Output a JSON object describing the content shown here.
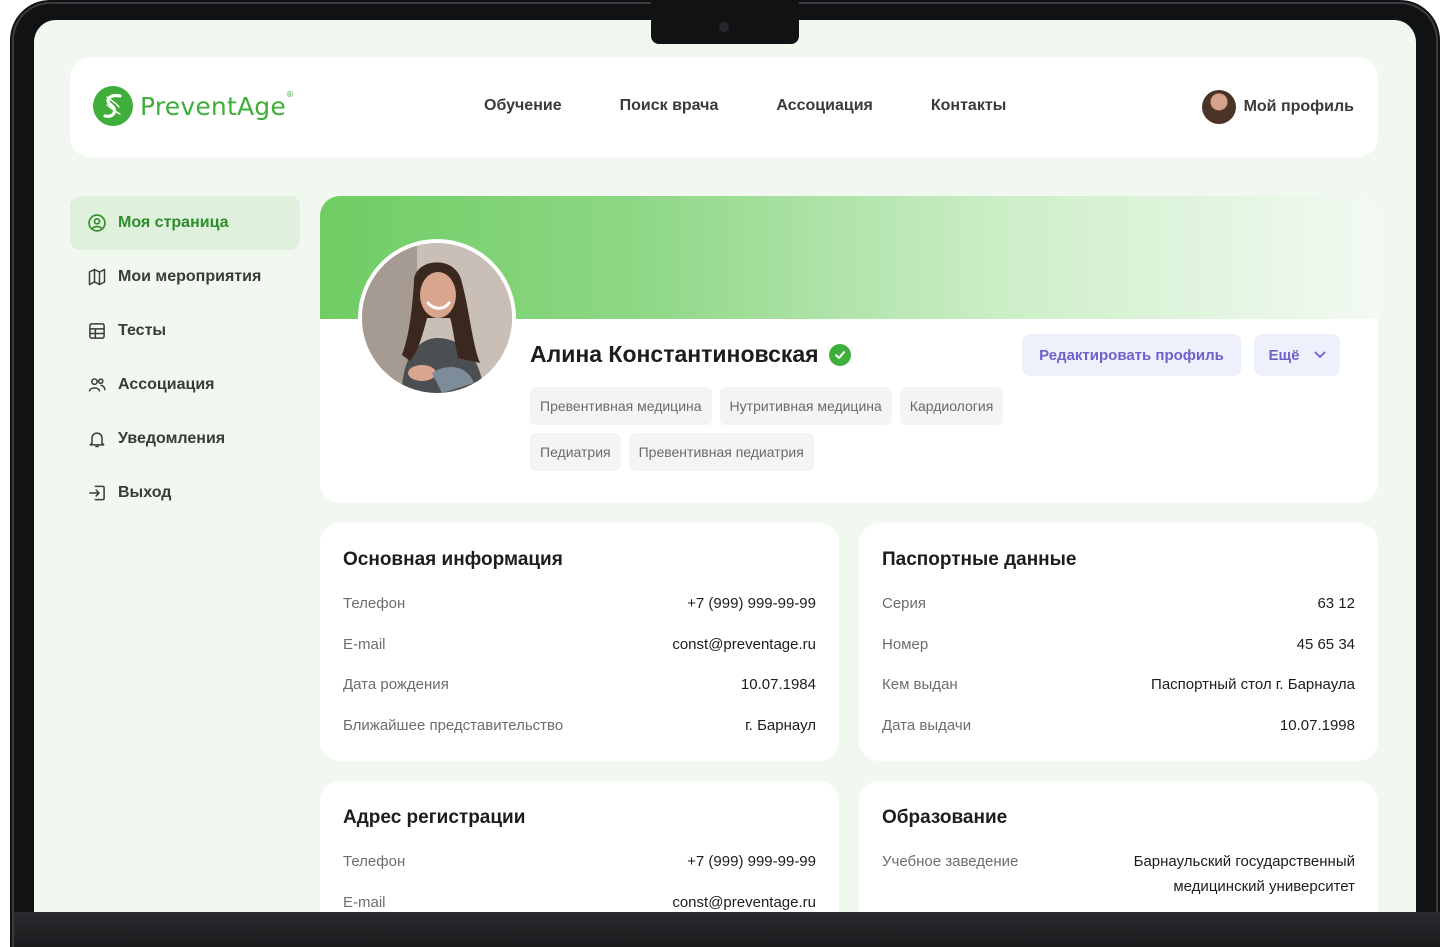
{
  "header": {
    "logo_text": "PreventAge",
    "logo_reg": "®",
    "nav": [
      "Обучение",
      "Поиск врача",
      "Ассоциация",
      "Контакты"
    ],
    "profile_label": "Мой профиль"
  },
  "sidebar": {
    "items": [
      {
        "label": "Моя страница",
        "icon": "user-circle-icon",
        "active": true
      },
      {
        "label": "Мои мероприятия",
        "icon": "map-icon",
        "active": false
      },
      {
        "label": "Тесты",
        "icon": "table-icon",
        "active": false
      },
      {
        "label": "Ассоциация",
        "icon": "users-icon",
        "active": false
      },
      {
        "label": "Уведомления",
        "icon": "bell-icon",
        "active": false
      },
      {
        "label": "Выход",
        "icon": "logout-icon",
        "active": false
      }
    ]
  },
  "profile": {
    "name": "Алина Константиновская",
    "verified": true,
    "edit_button": "Редактировать профиль",
    "more_button": "Ещё",
    "tags": [
      "Превентивная медицина",
      "Нутритивная медицина",
      "Кардиология",
      "Педиатрия",
      "Превентивная педиатрия"
    ]
  },
  "cards": {
    "basic": {
      "title": "Основная информация",
      "rows": [
        {
          "label": "Телефон",
          "value": "+7 (999) 999-99-99"
        },
        {
          "label": "E-mail",
          "value": "const@preventage.ru"
        },
        {
          "label": "Дата рождения",
          "value": "10.07.1984"
        },
        {
          "label": "Ближайшее представительство",
          "value": "г. Барнаул"
        }
      ]
    },
    "passport": {
      "title": "Паспортные данные",
      "rows": [
        {
          "label": "Серия",
          "value": "63 12"
        },
        {
          "label": "Номер",
          "value": "45 65 34"
        },
        {
          "label": "Кем выдан",
          "value": "Паспортный стол г. Барнаула"
        },
        {
          "label": "Дата выдачи",
          "value": "10.07.1998"
        }
      ]
    },
    "address": {
      "title": "Адрес регистрации",
      "rows": [
        {
          "label": "Телефон",
          "value": "+7 (999) 999-99-99"
        },
        {
          "label": "E-mail",
          "value": "const@preventage.ru"
        }
      ]
    },
    "education": {
      "title": "Образование",
      "rows": [
        {
          "label": "Учебное заведение",
          "value": "Барнаульский государственный медицинский университет"
        }
      ]
    }
  },
  "colors": {
    "brand_green": "#3fae3a",
    "active_bg": "#dff1dc",
    "button_bg": "#eef0fb",
    "button_text": "#6b63c9",
    "page_bg": "#f1f8f0"
  }
}
